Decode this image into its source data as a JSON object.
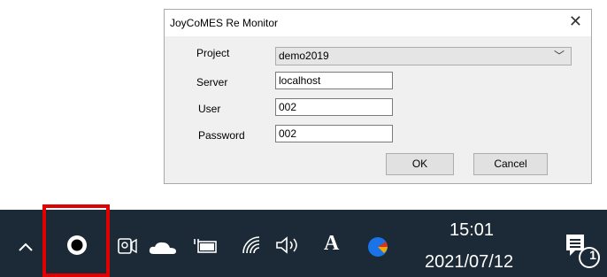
{
  "dialog": {
    "title": "JoyCoMES Re Monitor",
    "close_glyph": "✕",
    "project_label": "Project",
    "project_value": "demo2019",
    "server_label": "Server",
    "server_value": "localhost",
    "user_label": "User",
    "user_value": "002",
    "password_label": "Password",
    "password_value": "002",
    "ok_label": "OK",
    "cancel_label": "Cancel"
  },
  "taskbar": {
    "time": "15:01",
    "date": "2021/07/12",
    "notification_count": "1",
    "ime_label": "A",
    "icons": [
      "chevron-up-icon",
      "app-tray-icon",
      "camera-icon",
      "onedrive-cloud-icon",
      "battery-icon",
      "wifi-icon",
      "volume-icon",
      "ime-icon",
      "chrome-dot-icon",
      "action-center-icon"
    ]
  },
  "colors": {
    "taskbar_bg": "#1b2a36",
    "highlight": "#e10000",
    "dialog_bg": "#f0f0f0"
  }
}
